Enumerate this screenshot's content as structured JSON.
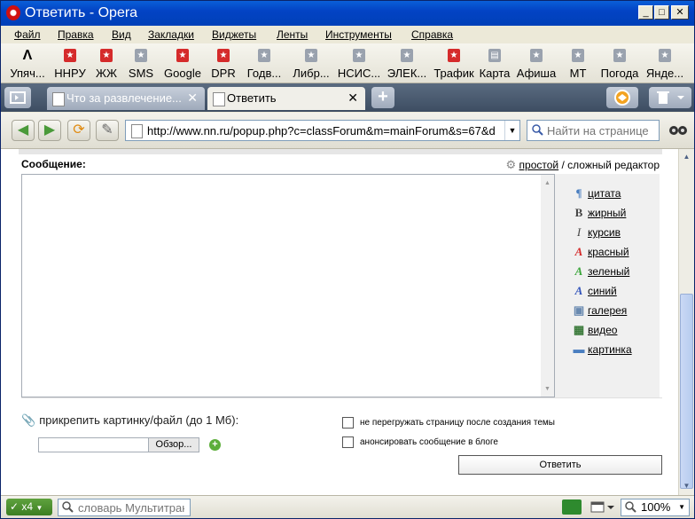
{
  "window": {
    "title": "Ответить - Opera"
  },
  "menu": [
    "Файл",
    "Правка",
    "Вид",
    "Закладки",
    "Виджеты",
    "Ленты",
    "Инструменты",
    "Справка"
  ],
  "bookmarks": [
    "Упяч...",
    "ННРУ",
    "ЖЖ",
    "SMS",
    "Google",
    "DPR",
    "Годв...",
    "Либр...",
    "НСИС...",
    "ЭЛЕК...",
    "Трафик",
    "Карта",
    "Афиша",
    "МТ",
    "Погода",
    "Янде..."
  ],
  "tabs": [
    {
      "label": "Что за развлечение..."
    },
    {
      "label": "Ответить"
    }
  ],
  "address": {
    "url": "http://www.nn.ru/popup.php?c=classForum&m=mainForum&s=67&d"
  },
  "search": {
    "placeholder": "Найти на странице"
  },
  "form": {
    "message_label": "Сообщение:",
    "mode_simple": "простой",
    "mode_sep": " / ",
    "mode_complex": "сложный редактор",
    "tools": [
      "цитата",
      "жирный",
      "курсив",
      "красный",
      "зеленый",
      "синий",
      "галерея",
      "видео",
      "картинка"
    ],
    "attach_label": "прикрепить картинку/файл (до 1 Мб):",
    "browse_label": "Обзор...",
    "checkbox_no_reload": "не перегружать страницу после создания темы",
    "checkbox_announce": "анонсировать сообщение в блоге",
    "submit_label": "Ответить"
  },
  "status": {
    "counter": "x4",
    "search_placeholder": "словарь Мультитран",
    "zoom": "100%"
  },
  "colors": {
    "title_bar": "#0343c4",
    "accent_red": "#d52b2b",
    "tool_green": "#3aa53a",
    "tool_blue": "#3355bb"
  }
}
